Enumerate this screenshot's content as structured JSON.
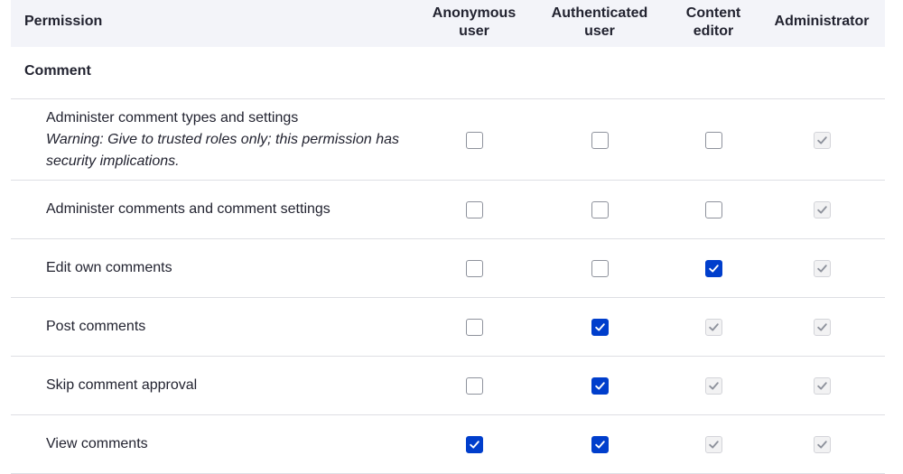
{
  "header": {
    "permission_label": "Permission",
    "roles": [
      {
        "line1": "Anonymous",
        "line2": "user"
      },
      {
        "line1": "Authenticated",
        "line2": "user"
      },
      {
        "line1": "Content",
        "line2": "editor"
      },
      {
        "line1": "Administrator",
        "line2": ""
      }
    ]
  },
  "group": {
    "title": "Comment"
  },
  "permissions": [
    {
      "title": "Administer comment types and settings",
      "warning": "Warning: Give to trusted roles only; this permission has security implications.",
      "states": [
        "unchecked",
        "unchecked",
        "unchecked",
        "disabled"
      ]
    },
    {
      "title": "Administer comments and comment settings",
      "warning": "",
      "states": [
        "unchecked",
        "unchecked",
        "unchecked",
        "disabled"
      ]
    },
    {
      "title": "Edit own comments",
      "warning": "",
      "states": [
        "unchecked",
        "unchecked",
        "checked",
        "disabled"
      ]
    },
    {
      "title": "Post comments",
      "warning": "",
      "states": [
        "unchecked",
        "checked",
        "disabled",
        "disabled"
      ]
    },
    {
      "title": "Skip comment approval",
      "warning": "",
      "states": [
        "unchecked",
        "checked",
        "disabled",
        "disabled"
      ]
    },
    {
      "title": "View comments",
      "warning": "",
      "states": [
        "checked",
        "checked",
        "disabled",
        "disabled"
      ]
    }
  ],
  "colors": {
    "header_bg": "#f3f4f9",
    "checked": "#003ecc",
    "row_border": "#dedfe4",
    "text": "#222330"
  },
  "icons": {
    "checkmark": "checkmark-icon"
  }
}
